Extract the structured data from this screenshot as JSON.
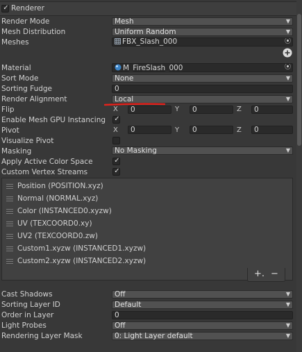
{
  "component": {
    "title": "Renderer",
    "enabled": true
  },
  "rows": {
    "render_mode": {
      "label": "Render Mode",
      "value": "Mesh"
    },
    "mesh_distribution": {
      "label": "Mesh Distribution",
      "value": "Uniform Random"
    },
    "meshes": {
      "label": "Meshes",
      "value": "FBX_Slash_000"
    },
    "material": {
      "label": "Material",
      "value": "M_FireSlash_000"
    },
    "sort_mode": {
      "label": "Sort Mode",
      "value": "None"
    },
    "sorting_fudge": {
      "label": "Sorting Fudge",
      "value": "0"
    },
    "render_alignment": {
      "label": "Render Alignment",
      "value": "Local"
    },
    "flip": {
      "label": "Flip",
      "x": "0",
      "y": "0",
      "z": "0"
    },
    "gpu_instancing": {
      "label": "Enable Mesh GPU Instancing",
      "checked": true
    },
    "pivot": {
      "label": "Pivot",
      "x": "0",
      "y": "0",
      "z": "0"
    },
    "visualize_pivot": {
      "label": "Visualize Pivot",
      "checked": false
    },
    "masking": {
      "label": "Masking",
      "value": "No Masking"
    },
    "apply_active_color_space": {
      "label": "Apply Active Color Space",
      "checked": true
    },
    "custom_vertex_streams": {
      "label": "Custom Vertex Streams",
      "checked": true
    },
    "cast_shadows": {
      "label": "Cast Shadows",
      "value": "Off"
    },
    "sorting_layer_id": {
      "label": "Sorting Layer ID",
      "value": "Default"
    },
    "order_in_layer": {
      "label": "Order in Layer",
      "value": "0"
    },
    "light_probes": {
      "label": "Light Probes",
      "value": "Off"
    },
    "rendering_layer_mask": {
      "label": "Rendering Layer Mask",
      "value": "0: Light Layer default"
    }
  },
  "axes": {
    "x": "X",
    "y": "Y",
    "z": "Z"
  },
  "streams": [
    "Position (POSITION.xyz)",
    "Normal (NORMAL.xyz)",
    "Color (INSTANCED0.xyzw)",
    "UV (TEXCOORD0.xy)",
    "UV2 (TEXCOORD0.zw)",
    "Custom1.xyzw (INSTANCED1.xyzw)",
    "Custom2.xyzw (INSTANCED2.xyzw)"
  ],
  "stream_buttons": {
    "add": "+.",
    "remove": "−"
  },
  "icons": {
    "add_mesh": "plus-circle-icon",
    "picker": "target-icon",
    "mesh": "mesh-icon",
    "material": "material-sphere-icon"
  },
  "colors": {
    "annotation": "#e3221c",
    "panel": "#383838",
    "field": "#515151"
  }
}
